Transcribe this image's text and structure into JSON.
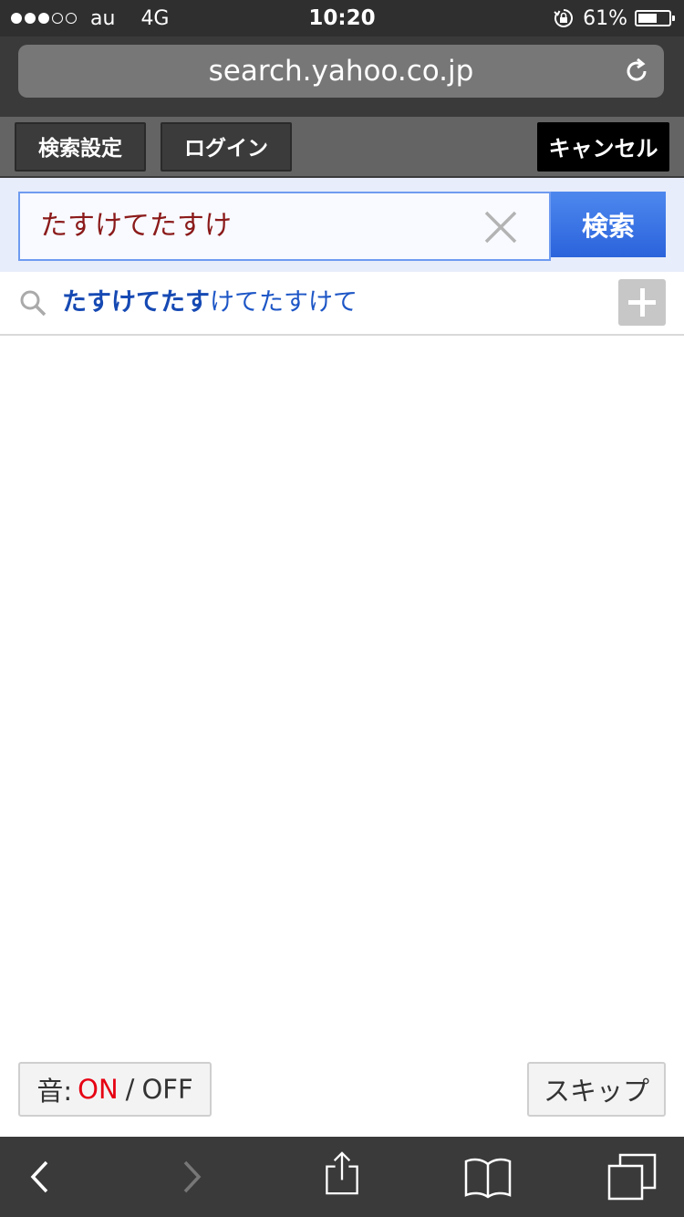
{
  "status_bar": {
    "carrier": "au",
    "network": "4G",
    "time": "10:20",
    "battery_percent": "61%",
    "battery_level": 0.61,
    "signal_bars_filled": 3,
    "signal_bars_total": 5,
    "icons": [
      "signal-dots-icon",
      "orientation-lock-icon",
      "battery-icon"
    ]
  },
  "browser": {
    "url": "search.yahoo.co.jp",
    "reload_icon": "reload-icon"
  },
  "toolbar": {
    "settings_label": "検索設定",
    "login_label": "ログイン",
    "cancel_label": "キャンセル"
  },
  "search": {
    "query": "たすけてたすけ",
    "button_label": "検索",
    "clear_icon": "close-icon"
  },
  "suggestions": [
    {
      "match": "たすけてたす",
      "rest": "けてたすけて"
    }
  ],
  "sound_toggle": {
    "prefix": "音:",
    "on_label": "ON",
    "separator": "/",
    "off_label": "OFF",
    "on_color": "#e60012"
  },
  "skip_label": "スキップ",
  "bottom_bar": {
    "icons": [
      "back-arrow-icon",
      "forward-arrow-icon",
      "share-icon",
      "bookmarks-icon",
      "tabs-icon"
    ]
  }
}
